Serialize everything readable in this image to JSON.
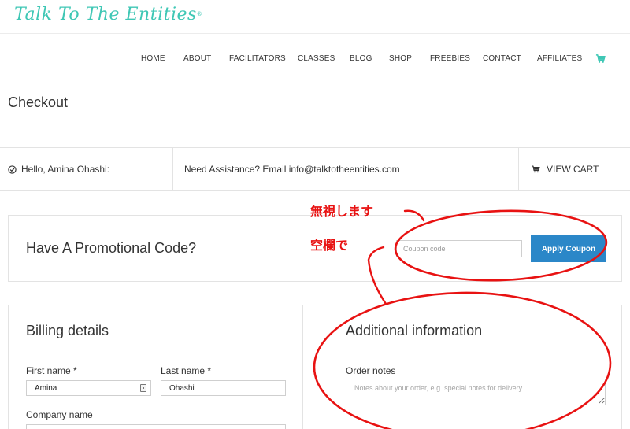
{
  "brand": {
    "logo_text": "Talk To The Entities",
    "logo_mark": "®",
    "accent": "#3fc7b5"
  },
  "nav": {
    "items": [
      "HOME",
      "ABOUT",
      "FACILITATORS",
      "CLASSES",
      "BLOG",
      "SHOP",
      "FREEBIES",
      "CONTACT",
      "AFFILIATES"
    ],
    "cart_icon": "shopping-cart-icon"
  },
  "page": {
    "title": "Checkout"
  },
  "info_bar": {
    "greeting": "Hello, Amina Ohashi:",
    "assistance": "Need Assistance? Email info@talktotheentities.com",
    "view_cart": "VIEW CART"
  },
  "promo": {
    "title": "Have A Promotional Code?",
    "coupon_placeholder": "Coupon code",
    "coupon_value": "",
    "apply_label": "Apply Coupon",
    "button_color": "#2b87c8"
  },
  "billing": {
    "title": "Billing details",
    "first_name_label": "First name",
    "first_name_value": "Amina",
    "last_name_label": "Last name",
    "last_name_value": "Ohashi",
    "required_mark": "*",
    "company_label": "Company name"
  },
  "additional": {
    "title": "Additional information",
    "order_notes_label": "Order notes",
    "order_notes_placeholder": "Notes about your order, e.g. special notes for delivery."
  },
  "annotations": {
    "ignore_text": "無視します",
    "blank_text": "空欄で",
    "color": "#e81212"
  }
}
